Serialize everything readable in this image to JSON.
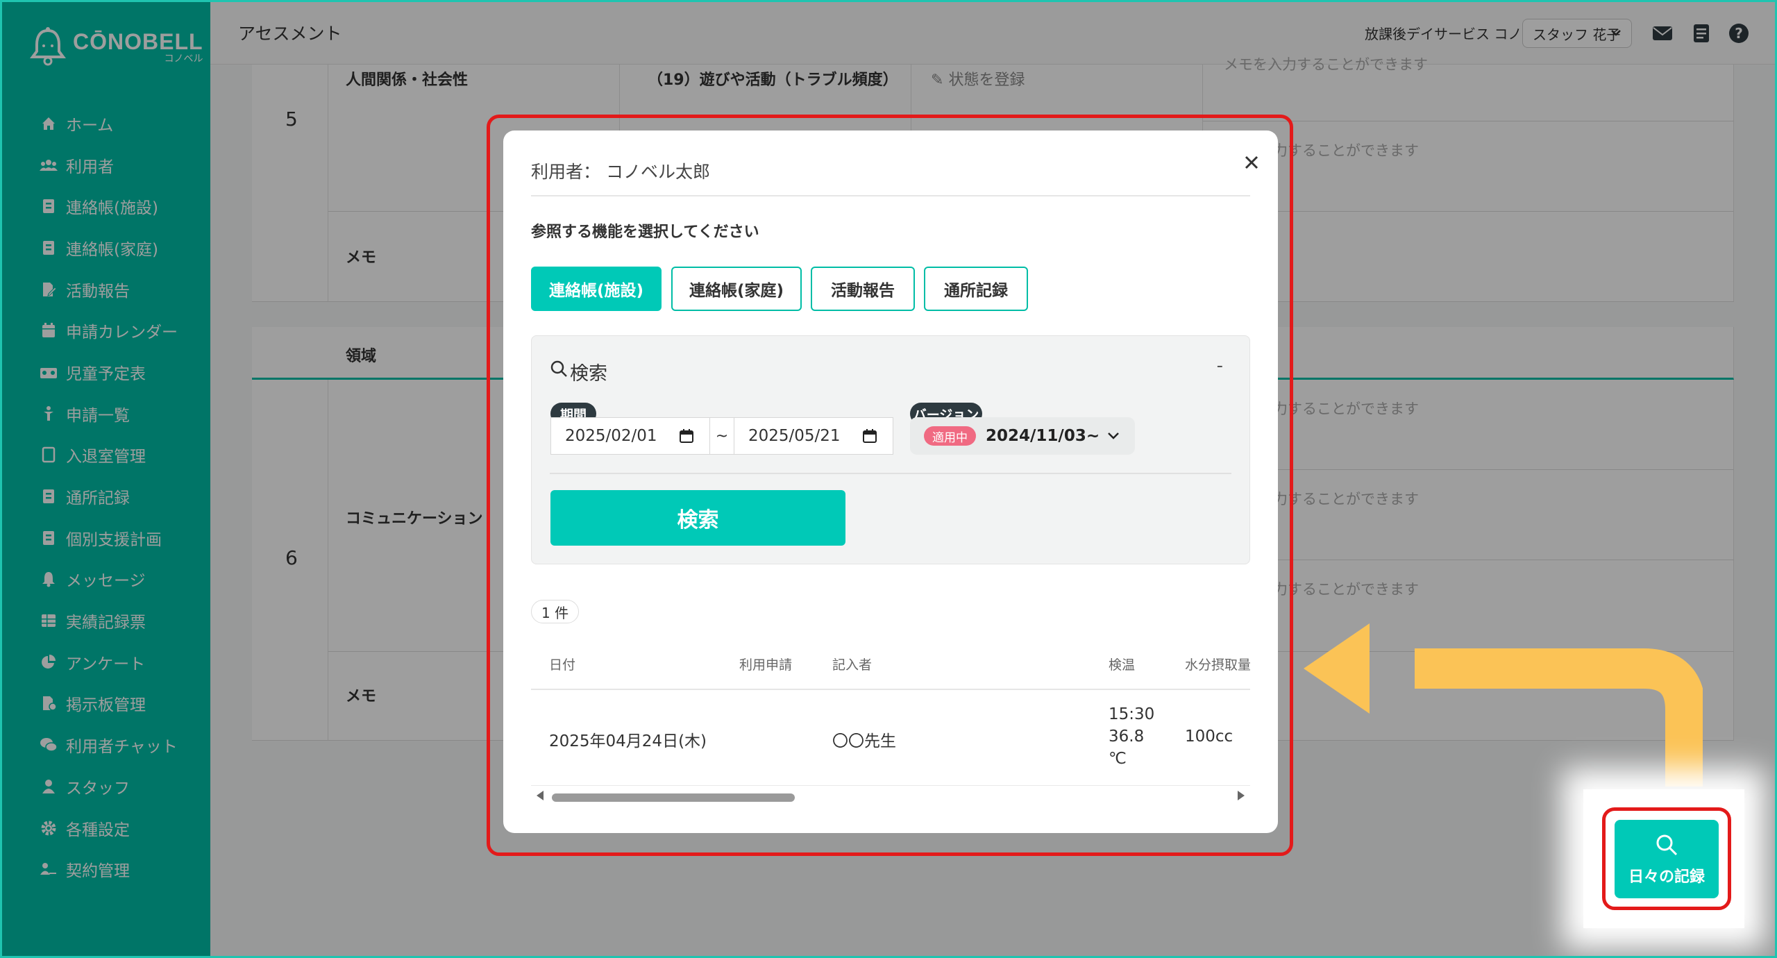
{
  "app": {
    "logo_text": "CŌNOBELL",
    "logo_sub": "コノベル",
    "page_title": "アセスメント",
    "facility": "放課後デイサービス コノベル",
    "staff": "スタッフ 花子"
  },
  "sidebar": {
    "items": [
      {
        "label": "ホーム",
        "icon": "home-icon"
      },
      {
        "label": "利用者",
        "icon": "users-icon"
      },
      {
        "label": "連絡帳(施設)",
        "icon": "contact-book-icon"
      },
      {
        "label": "連絡帳(家庭)",
        "icon": "contact-book-icon"
      },
      {
        "label": "活動報告",
        "icon": "report-icon"
      },
      {
        "label": "申請カレンダー",
        "icon": "calendar-icon"
      },
      {
        "label": "児童予定表",
        "icon": "schedule-icon"
      },
      {
        "label": "申請一覧",
        "icon": "request-icon"
      },
      {
        "label": "入退室管理",
        "icon": "door-icon"
      },
      {
        "label": "通所記録",
        "icon": "record-icon"
      },
      {
        "label": "個別支援計画",
        "icon": "plan-icon"
      },
      {
        "label": "メッセージ",
        "icon": "bell-icon"
      },
      {
        "label": "実績記録票",
        "icon": "table-icon"
      },
      {
        "label": "アンケート",
        "icon": "pie-icon"
      },
      {
        "label": "掲示板管理",
        "icon": "board-icon"
      },
      {
        "label": "利用者チャット",
        "icon": "chat-icon"
      },
      {
        "label": "スタッフ",
        "icon": "staff-icon"
      },
      {
        "label": "各種設定",
        "icon": "gear-icon"
      },
      {
        "label": "契約管理",
        "icon": "contract-icon"
      }
    ]
  },
  "background": {
    "row5_number": "5",
    "row5_area": "人間関係・社会性",
    "row5_item": "（19）遊びや活動（トラブル頻度）",
    "row5_status": "状態を登録",
    "memo_label": "メモ",
    "area_header": "領域",
    "row6_number": "6",
    "row6_area": "コミュニケーション",
    "hint_top": "メモを入力することができます",
    "hint_partial": "入力することができます"
  },
  "modal": {
    "user_label": "利用者： コノベル太郎",
    "prompt": "参照する機能を選択してください",
    "tabs": [
      "連絡帳(施設)",
      "連絡帳(家庭)",
      "活動報告",
      "通所記録"
    ],
    "search_title": "検索",
    "collapse": "-",
    "period_label": "期間",
    "date_from": "2025/02/01",
    "tilde": "~",
    "date_to": "2025/05/21",
    "version_label": "バージョン",
    "version_badge": "適用中",
    "version_value": "2024/11/03~",
    "search_button": "検索",
    "count": "1 件",
    "columns": [
      "日付",
      "利用申請",
      "記入者",
      "検温",
      "水分摂取量"
    ],
    "row": {
      "date": "2025年04月24日(木)",
      "writer": "〇〇先生",
      "temp_time": "15:30",
      "temp_value": "36.8",
      "temp_unit": "℃",
      "water": "100cc"
    }
  },
  "fab": {
    "label": "日々の記録"
  },
  "colors": {
    "brand": "#00bda6",
    "accent": "#00c9b7",
    "highlight": "#e31a1a",
    "arrow": "#fbc356"
  }
}
